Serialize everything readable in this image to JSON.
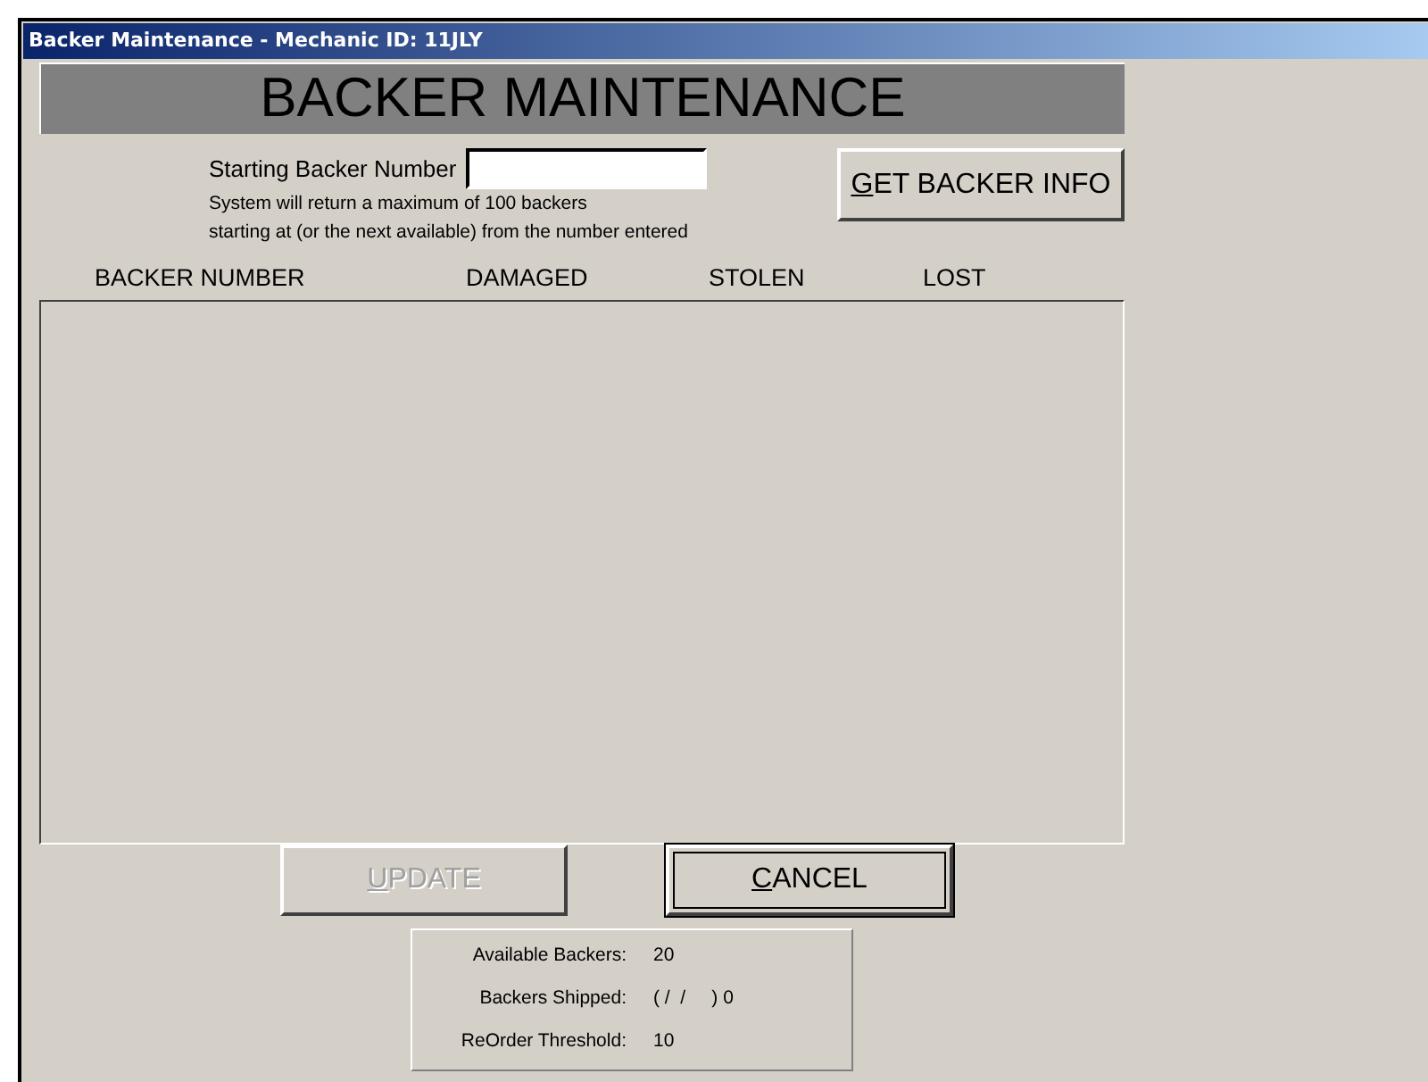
{
  "window": {
    "title": "Backer Maintenance - Mechanic ID: 11JLY"
  },
  "header": "BACKER MAINTENANCE",
  "search": {
    "label": "Starting Backer Number",
    "hint": [
      "System will return a maximum of 100 backers",
      "starting at (or the next available) from the number entered"
    ]
  },
  "get_button": {
    "label": "GET BACKER INFO",
    "mnemonic": true,
    "disabled": false,
    "default": false
  },
  "table": {
    "columns": [
      "BACKER NUMBER",
      "DAMAGED",
      "STOLEN",
      "LOST"
    ]
  },
  "buttons": [
    {
      "label": "UPDATE",
      "mnemonic": true,
      "disabled": true,
      "default": false
    },
    {
      "label": "CANCEL",
      "mnemonic": true,
      "disabled": false,
      "default": true
    }
  ],
  "summary": [
    {
      "label": "Available Backers:",
      "value": "20"
    },
    {
      "label": "Backers Shipped:",
      "value": "( /  /     ) 0"
    },
    {
      "label": "ReOrder Threshold:",
      "value": "10"
    }
  ]
}
